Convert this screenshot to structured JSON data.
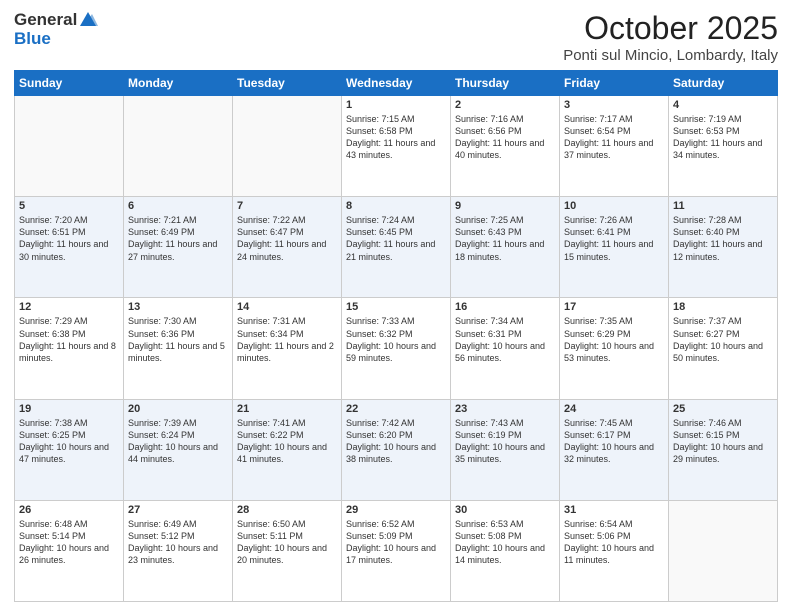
{
  "header": {
    "logo_general": "General",
    "logo_blue": "Blue",
    "title": "October 2025",
    "location": "Ponti sul Mincio, Lombardy, Italy"
  },
  "days_of_week": [
    "Sunday",
    "Monday",
    "Tuesday",
    "Wednesday",
    "Thursday",
    "Friday",
    "Saturday"
  ],
  "weeks": [
    [
      {
        "day": "",
        "info": ""
      },
      {
        "day": "",
        "info": ""
      },
      {
        "day": "",
        "info": ""
      },
      {
        "day": "1",
        "info": "Sunrise: 7:15 AM\nSunset: 6:58 PM\nDaylight: 11 hours and 43 minutes."
      },
      {
        "day": "2",
        "info": "Sunrise: 7:16 AM\nSunset: 6:56 PM\nDaylight: 11 hours and 40 minutes."
      },
      {
        "day": "3",
        "info": "Sunrise: 7:17 AM\nSunset: 6:54 PM\nDaylight: 11 hours and 37 minutes."
      },
      {
        "day": "4",
        "info": "Sunrise: 7:19 AM\nSunset: 6:53 PM\nDaylight: 11 hours and 34 minutes."
      }
    ],
    [
      {
        "day": "5",
        "info": "Sunrise: 7:20 AM\nSunset: 6:51 PM\nDaylight: 11 hours and 30 minutes."
      },
      {
        "day": "6",
        "info": "Sunrise: 7:21 AM\nSunset: 6:49 PM\nDaylight: 11 hours and 27 minutes."
      },
      {
        "day": "7",
        "info": "Sunrise: 7:22 AM\nSunset: 6:47 PM\nDaylight: 11 hours and 24 minutes."
      },
      {
        "day": "8",
        "info": "Sunrise: 7:24 AM\nSunset: 6:45 PM\nDaylight: 11 hours and 21 minutes."
      },
      {
        "day": "9",
        "info": "Sunrise: 7:25 AM\nSunset: 6:43 PM\nDaylight: 11 hours and 18 minutes."
      },
      {
        "day": "10",
        "info": "Sunrise: 7:26 AM\nSunset: 6:41 PM\nDaylight: 11 hours and 15 minutes."
      },
      {
        "day": "11",
        "info": "Sunrise: 7:28 AM\nSunset: 6:40 PM\nDaylight: 11 hours and 12 minutes."
      }
    ],
    [
      {
        "day": "12",
        "info": "Sunrise: 7:29 AM\nSunset: 6:38 PM\nDaylight: 11 hours and 8 minutes."
      },
      {
        "day": "13",
        "info": "Sunrise: 7:30 AM\nSunset: 6:36 PM\nDaylight: 11 hours and 5 minutes."
      },
      {
        "day": "14",
        "info": "Sunrise: 7:31 AM\nSunset: 6:34 PM\nDaylight: 11 hours and 2 minutes."
      },
      {
        "day": "15",
        "info": "Sunrise: 7:33 AM\nSunset: 6:32 PM\nDaylight: 10 hours and 59 minutes."
      },
      {
        "day": "16",
        "info": "Sunrise: 7:34 AM\nSunset: 6:31 PM\nDaylight: 10 hours and 56 minutes."
      },
      {
        "day": "17",
        "info": "Sunrise: 7:35 AM\nSunset: 6:29 PM\nDaylight: 10 hours and 53 minutes."
      },
      {
        "day": "18",
        "info": "Sunrise: 7:37 AM\nSunset: 6:27 PM\nDaylight: 10 hours and 50 minutes."
      }
    ],
    [
      {
        "day": "19",
        "info": "Sunrise: 7:38 AM\nSunset: 6:25 PM\nDaylight: 10 hours and 47 minutes."
      },
      {
        "day": "20",
        "info": "Sunrise: 7:39 AM\nSunset: 6:24 PM\nDaylight: 10 hours and 44 minutes."
      },
      {
        "day": "21",
        "info": "Sunrise: 7:41 AM\nSunset: 6:22 PM\nDaylight: 10 hours and 41 minutes."
      },
      {
        "day": "22",
        "info": "Sunrise: 7:42 AM\nSunset: 6:20 PM\nDaylight: 10 hours and 38 minutes."
      },
      {
        "day": "23",
        "info": "Sunrise: 7:43 AM\nSunset: 6:19 PM\nDaylight: 10 hours and 35 minutes."
      },
      {
        "day": "24",
        "info": "Sunrise: 7:45 AM\nSunset: 6:17 PM\nDaylight: 10 hours and 32 minutes."
      },
      {
        "day": "25",
        "info": "Sunrise: 7:46 AM\nSunset: 6:15 PM\nDaylight: 10 hours and 29 minutes."
      }
    ],
    [
      {
        "day": "26",
        "info": "Sunrise: 6:48 AM\nSunset: 5:14 PM\nDaylight: 10 hours and 26 minutes."
      },
      {
        "day": "27",
        "info": "Sunrise: 6:49 AM\nSunset: 5:12 PM\nDaylight: 10 hours and 23 minutes."
      },
      {
        "day": "28",
        "info": "Sunrise: 6:50 AM\nSunset: 5:11 PM\nDaylight: 10 hours and 20 minutes."
      },
      {
        "day": "29",
        "info": "Sunrise: 6:52 AM\nSunset: 5:09 PM\nDaylight: 10 hours and 17 minutes."
      },
      {
        "day": "30",
        "info": "Sunrise: 6:53 AM\nSunset: 5:08 PM\nDaylight: 10 hours and 14 minutes."
      },
      {
        "day": "31",
        "info": "Sunrise: 6:54 AM\nSunset: 5:06 PM\nDaylight: 10 hours and 11 minutes."
      },
      {
        "day": "",
        "info": ""
      }
    ]
  ]
}
